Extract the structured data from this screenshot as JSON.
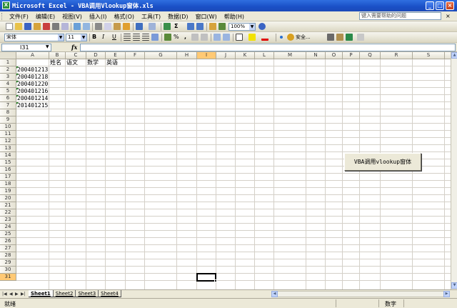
{
  "window": {
    "title": "Microsoft Excel - VBA调用Vlookup窗体.xls",
    "icon_label": "X",
    "minimize_label": "_",
    "maximize_label": "□",
    "close_label": "×"
  },
  "menu": {
    "items": [
      "文件(F)",
      "编辑(E)",
      "视图(V)",
      "插入(I)",
      "格式(O)",
      "工具(T)",
      "数据(D)",
      "窗口(W)",
      "帮助(H)"
    ],
    "help_placeholder": "键入需要帮助的问题",
    "close_label": "×"
  },
  "toolbar": {
    "zoom": "100%",
    "font_name": "宋体",
    "font_size": "11",
    "bold": "B",
    "italic": "I",
    "underline": "U",
    "security_label": "安全...",
    "percent_label": "%",
    "comma_label": ",",
    "sum_label": "Σ"
  },
  "formula_bar": {
    "name_box": "I31",
    "fx": "fx",
    "value": ""
  },
  "grid": {
    "columns": [
      "A",
      "B",
      "C",
      "D",
      "E",
      "F",
      "G",
      "H",
      "I",
      "J",
      "K",
      "L",
      "M",
      "N",
      "O",
      "P",
      "Q",
      "R",
      "S",
      "T"
    ],
    "rows": [
      "1",
      "2",
      "3",
      "4",
      "5",
      "6",
      "7",
      "8",
      "9",
      "10",
      "11",
      "12",
      "13",
      "14",
      "15",
      "16",
      "17",
      "18",
      "19",
      "20",
      "21",
      "22",
      "23",
      "24",
      "25",
      "26",
      "27",
      "28",
      "29",
      "30",
      "31"
    ],
    "selected_column": "I",
    "selected_row": "31",
    "headers": [
      "姓名",
      "语文",
      "数学",
      "英语"
    ],
    "ids": [
      "200401213",
      "200401218",
      "200401220",
      "200401216",
      "200401214",
      "201401215"
    ]
  },
  "vba_button": {
    "label": "VBA调用vlookup窗体"
  },
  "sheets": {
    "tabs": [
      "Sheet1",
      "Sheet2",
      "Sheet3",
      "Sheet4"
    ],
    "active": "Sheet1"
  },
  "status": {
    "text": "就绪",
    "mode": "数字"
  }
}
